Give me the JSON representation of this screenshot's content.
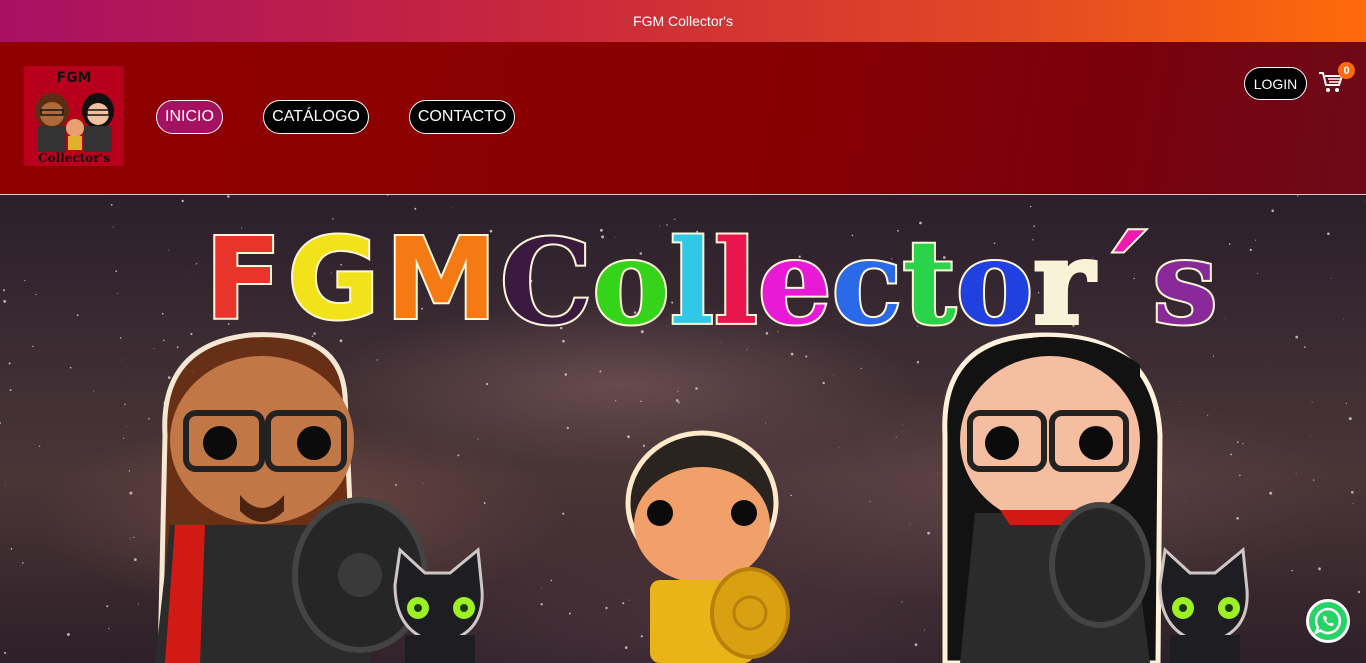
{
  "topbar": {
    "text": "FGM Collector's"
  },
  "header": {
    "logo": {
      "alt": "FGM Collector's",
      "line1": "FGM",
      "line2": "Collector's"
    },
    "nav": [
      {
        "label": "INICIO",
        "active": true
      },
      {
        "label": "CATÁLOGO",
        "active": false
      },
      {
        "label": "CONTACTO",
        "active": false
      }
    ],
    "login_label": "LOGIN",
    "cart_count": "0"
  },
  "hero": {
    "banner_title_part1": "FGM",
    "banner_title_part2": "Collector´s",
    "alt": "FGM Collector's"
  },
  "colors": {
    "topbar_start": "#a81063",
    "topbar_end": "#ff6a0a",
    "header_bg": "#880000",
    "active_nav": "#a51060",
    "badge": "#ff6a0a",
    "whatsapp": "#25d366"
  },
  "icons": [
    "cart-icon",
    "whatsapp-icon"
  ]
}
